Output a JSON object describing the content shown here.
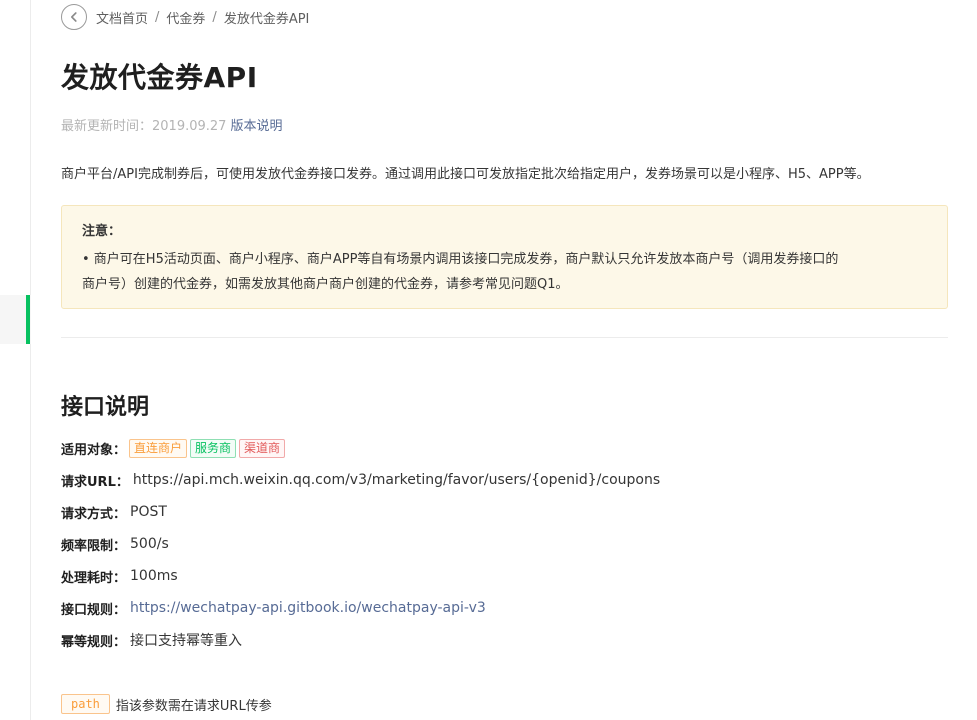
{
  "breadcrumb": {
    "items": [
      "文档首页",
      "代金券",
      "发放代金券API"
    ],
    "separator": "/"
  },
  "page": {
    "title": "发放代金券API",
    "updated_label": "最新更新时间：2019.09.27",
    "version_link": "版本说明",
    "intro": "商户平台/API完成制券后，可使用发放代金券接口发券。通过调用此接口可发放指定批次给指定用户，发券场景可以是小程序、H5、APP等。"
  },
  "notice": {
    "title": "注意：",
    "line1": "• 商户可在H5活动页面、商户小程序、商户APP等自有场景内调用该接口完成发券，商户默认只允许发放本商户号（调用发券接口的",
    "line2": "商户号）创建的代金券，如需发放其他商户商户创建的代金券，请参考常见问题Q1。"
  },
  "section": {
    "title": "接口说明"
  },
  "props": {
    "audience_label": "适用对象：",
    "tags": [
      {
        "label": "直连商户",
        "color": "#fa9d3b"
      },
      {
        "label": "服务商",
        "color": "#07c160"
      },
      {
        "label": "渠道商",
        "color": "#e25a5a"
      }
    ],
    "url_label": "请求URL：",
    "url_value": "https://api.mch.weixin.qq.com/v3/marketing/favor/users/{openid}/coupons",
    "method_label": "请求方式：",
    "method_value": "POST",
    "rate_label": "频率限制：",
    "rate_value": "500/s",
    "time_label": "处理耗时：",
    "time_value": "100ms",
    "rules_label": "接口规则：",
    "rules_link": "https://wechatpay-api.gitbook.io/wechatpay-api-v3",
    "idempotent_label": "幂等规则：",
    "idempotent_value": "接口支持幂等重入"
  },
  "legend": {
    "path_chip": "path",
    "path_desc": "指该参数需在请求URL传参"
  },
  "colors": {
    "accent_green": "#07c160",
    "link_blue": "#576b95",
    "notice_bg": "#fdf8e8"
  },
  "icons": {
    "back": "chevron-left-icon"
  }
}
